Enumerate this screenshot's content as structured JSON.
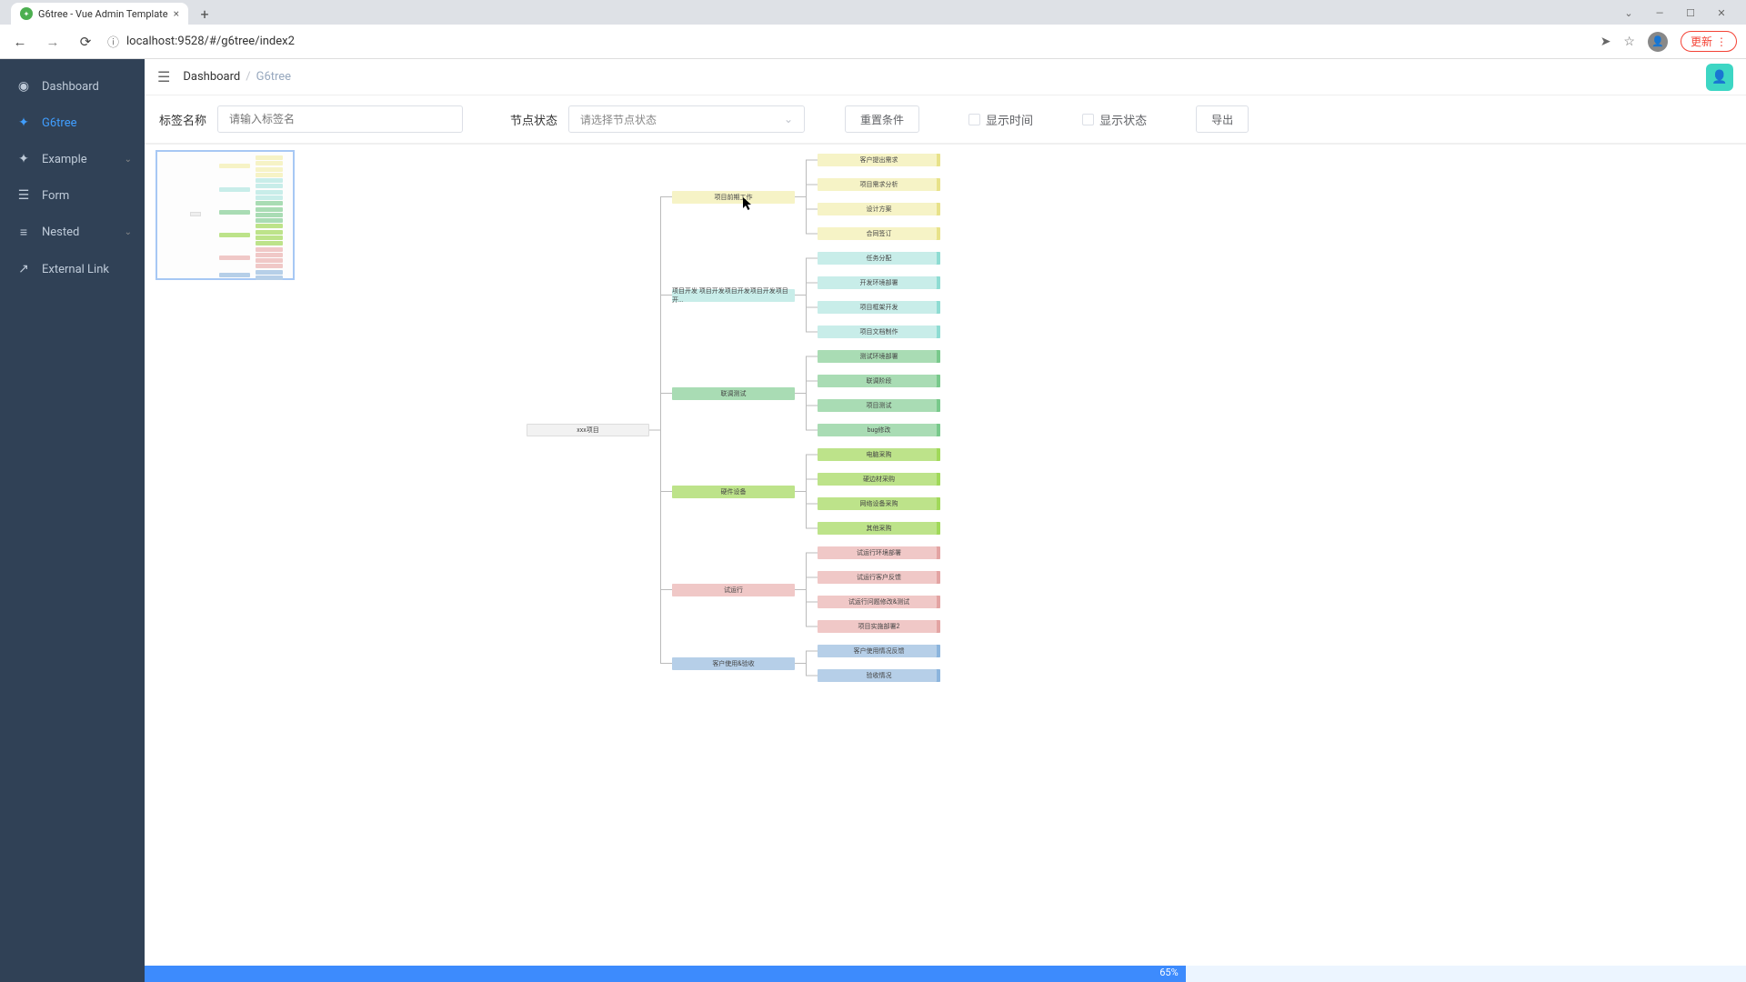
{
  "browser": {
    "tab_title": "G6tree - Vue Admin Template",
    "url": "localhost:9528/#/g6tree/index2",
    "update_label": "更新"
  },
  "sidebar": {
    "items": [
      {
        "label": "Dashboard"
      },
      {
        "label": "G6tree"
      },
      {
        "label": "Example"
      },
      {
        "label": "Form"
      },
      {
        "label": "Nested"
      },
      {
        "label": "External Link"
      }
    ]
  },
  "breadcrumb": {
    "root": "Dashboard",
    "current": "G6tree"
  },
  "filters": {
    "label_name": "标签名称",
    "label_name_placeholder": "请输入标签名",
    "status_label": "节点状态",
    "status_placeholder": "请选择节点状态",
    "reset_label": "重置条件",
    "show_time_label": "显示时间",
    "show_status_label": "显示状态",
    "export_label": "导出"
  },
  "tree": {
    "root": "xxx项目",
    "categories": [
      {
        "label": "项目前期工作",
        "color": "yellow",
        "leaves": [
          "客户提出需求",
          "项目需求分析",
          "设计方案",
          "合同签订"
        ]
      },
      {
        "label": "项目开发 项目开发项目开发项目开发项目开...",
        "color": "cyan",
        "leaves": [
          "任务分配",
          "开发环境部署",
          "项目框架开发",
          "项目文档制作"
        ]
      },
      {
        "label": "联调测试",
        "color": "green",
        "leaves": [
          "测试环境部署",
          "联调阶段",
          "项目测试",
          "bug修改"
        ]
      },
      {
        "label": "硬件设备",
        "color": "lime",
        "leaves": [
          "电脑采购",
          "硬边材采购",
          "网络设备采购",
          "其他采购"
        ]
      },
      {
        "label": "试运行",
        "color": "pink",
        "leaves": [
          "试运行环境部署",
          "试运行客户反馈",
          "试运行问题修改&测试",
          "项目实施部署2"
        ]
      },
      {
        "label": "客户使用&验收",
        "color": "blue",
        "leaves": [
          "客户使用情况反馈",
          "验收情况"
        ]
      }
    ]
  },
  "progress": {
    "percent": 65,
    "label": "65%"
  }
}
